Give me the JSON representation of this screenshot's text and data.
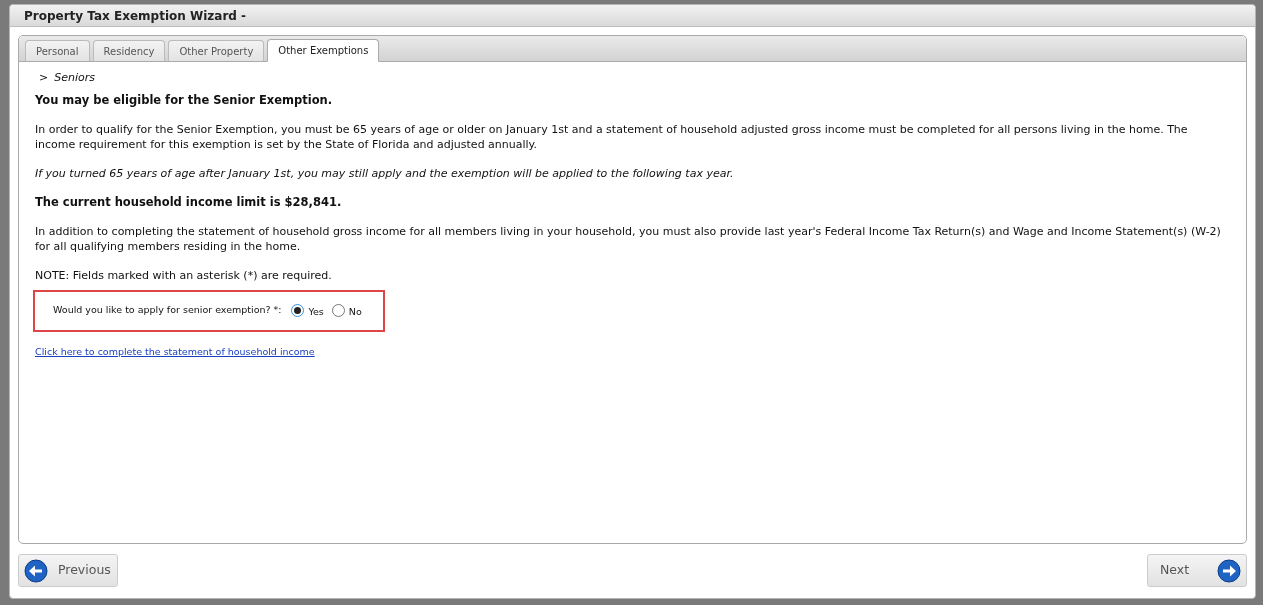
{
  "window": {
    "title": "Property Tax Exemption Wizard -"
  },
  "tabs": [
    {
      "label": "Personal",
      "selected": false
    },
    {
      "label": "Residency",
      "selected": false
    },
    {
      "label": "Other Property",
      "selected": false
    },
    {
      "label": "Other Exemptions",
      "selected": true
    }
  ],
  "breadcrumb": {
    "marker": ">",
    "label": "Seniors"
  },
  "paragraphs": [
    {
      "kind": "bold",
      "text": "You may be eligible for the Senior Exemption."
    },
    {
      "kind": "plain",
      "text": "In order to qualify for the Senior Exemption, you must be 65 years of age or older on January 1st and a statement of household adjusted gross income must be completed for all persons living in the home. The income requirement for this exemption is set by the State of Florida and adjusted annually."
    },
    {
      "kind": "italic",
      "text": "If you turned 65 years of age after January 1st, you may still apply and the exemption will be applied to the following tax year."
    },
    {
      "kind": "bold",
      "text": "The current household income limit is $28,841."
    },
    {
      "kind": "plain",
      "text": "In addition to completing the statement of household gross income for all members living in your household, you must also provide last year's Federal Income Tax Return(s) and Wage and Income Statement(s) (W-2) for all qualifying members residing in the home."
    },
    {
      "kind": "plain",
      "text": "NOTE: Fields marked with an asterisk (*) are required."
    }
  ],
  "question": {
    "label": "Would you like to apply for senior exemption? *:",
    "options": [
      {
        "label": "Yes",
        "selected": true
      },
      {
        "label": "No",
        "selected": false
      }
    ]
  },
  "link": "Click here to complete the statement of household income",
  "buttons": {
    "previous": "Previous",
    "next": "Next"
  }
}
